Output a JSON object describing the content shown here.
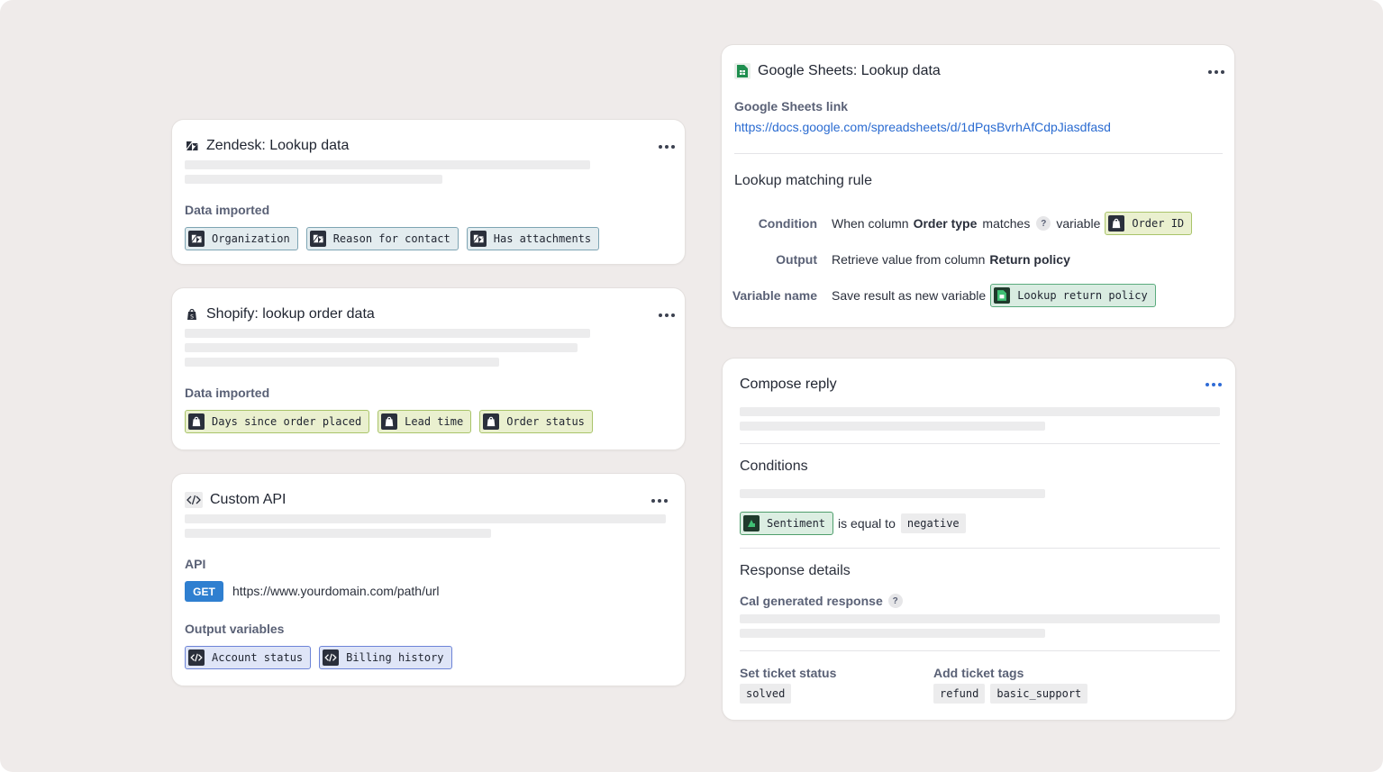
{
  "zendesk": {
    "title": "Zendesk: Lookup data",
    "data_label": "Data imported",
    "chips": [
      "Organization",
      "Reason for contact",
      "Has attachments"
    ]
  },
  "shopify": {
    "title": "Shopify: lookup order data",
    "data_label": "Data imported",
    "chips": [
      "Days since order placed",
      "Lead time",
      "Order status"
    ]
  },
  "custom_api": {
    "title": "Custom API",
    "api_label": "API",
    "method": "GET",
    "url": "https://www.yourdomain.com/path/url",
    "output_label": "Output variables",
    "chips": [
      "Account status",
      "Billing history"
    ]
  },
  "sheets": {
    "title": "Google Sheets: Lookup data",
    "link_label": "Google Sheets link",
    "link": "https://docs.google.com/spreadsheets/d/1dPqsBvrhAfCdpJiasdfasd",
    "rule_title": "Lookup matching rule",
    "condition": {
      "key": "Condition",
      "pre": "When column",
      "column": "Order type",
      "mid": "matches",
      "help": "?",
      "post": "variable",
      "chip": "Order ID"
    },
    "output": {
      "key": "Output",
      "pre": "Retrieve value from column",
      "column": "Return policy"
    },
    "variable": {
      "key": "Variable name",
      "pre": "Save result as new variable",
      "chip": "Lookup return policy"
    }
  },
  "compose": {
    "title": "Compose reply",
    "conditions_title": "Conditions",
    "condition_chip": "Sentiment",
    "condition_op": "is equal to",
    "condition_value": "negative",
    "response_title": "Response details",
    "generated_label": "Cal generated response",
    "help": "?",
    "status_label": "Set ticket status",
    "status_value": "solved",
    "tags_label": "Add ticket tags",
    "tags": [
      "refund",
      "basic_support"
    ]
  },
  "icons": {
    "zendesk": "zendesk-icon",
    "shopify": "shopify-bag-icon",
    "code": "code-icon",
    "sheets": "google-sheets-icon",
    "more": "more-dots-icon"
  },
  "colors": {
    "background": "#efebea",
    "link": "#2a6bd1",
    "get_method": "#2f7fd0",
    "zendesk_chip": "#e3ecef",
    "shopify_chip": "#eaf0cf",
    "sheets_chip": "#d9ece1",
    "api_chip": "#dfe5f7"
  }
}
